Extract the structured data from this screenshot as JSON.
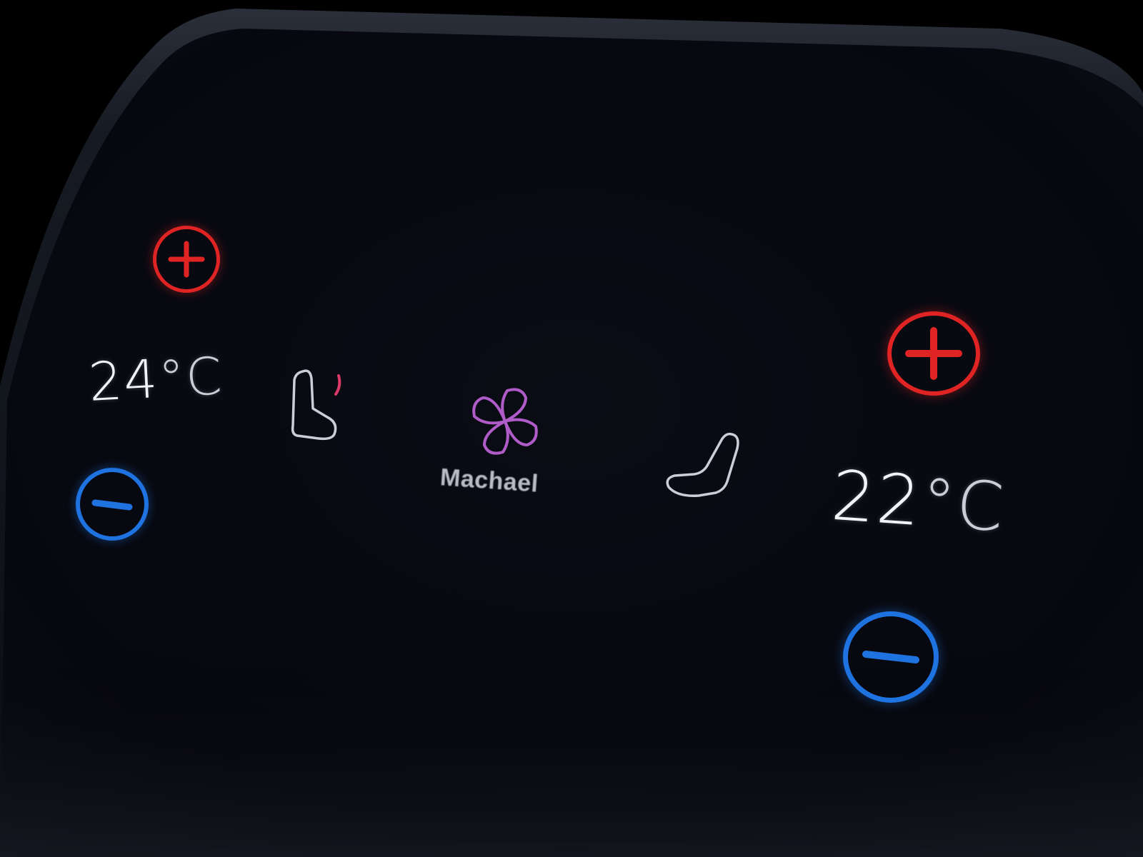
{
  "climate": {
    "driver": {
      "temperature_value": "24",
      "temperature_unit": "°C",
      "increase_icon": "plus-icon",
      "decrease_icon": "minus-icon",
      "seat_icon": "heated-seat-icon"
    },
    "passenger": {
      "temperature_value": "22",
      "temperature_unit": "°C",
      "increase_icon": "plus-icon",
      "decrease_icon": "minus-icon",
      "seat_icon": "seat-icon"
    },
    "fan": {
      "icon": "fan-icon",
      "profile_name": "Machael"
    }
  },
  "colors": {
    "increase": "#e02424",
    "decrease": "#1e73e0",
    "fan": "#b05cc8",
    "seat_heat": "#d93a6a",
    "icon_outline": "#c9ced8",
    "text": "#f2f4f8",
    "panel": "#0b0d14"
  }
}
